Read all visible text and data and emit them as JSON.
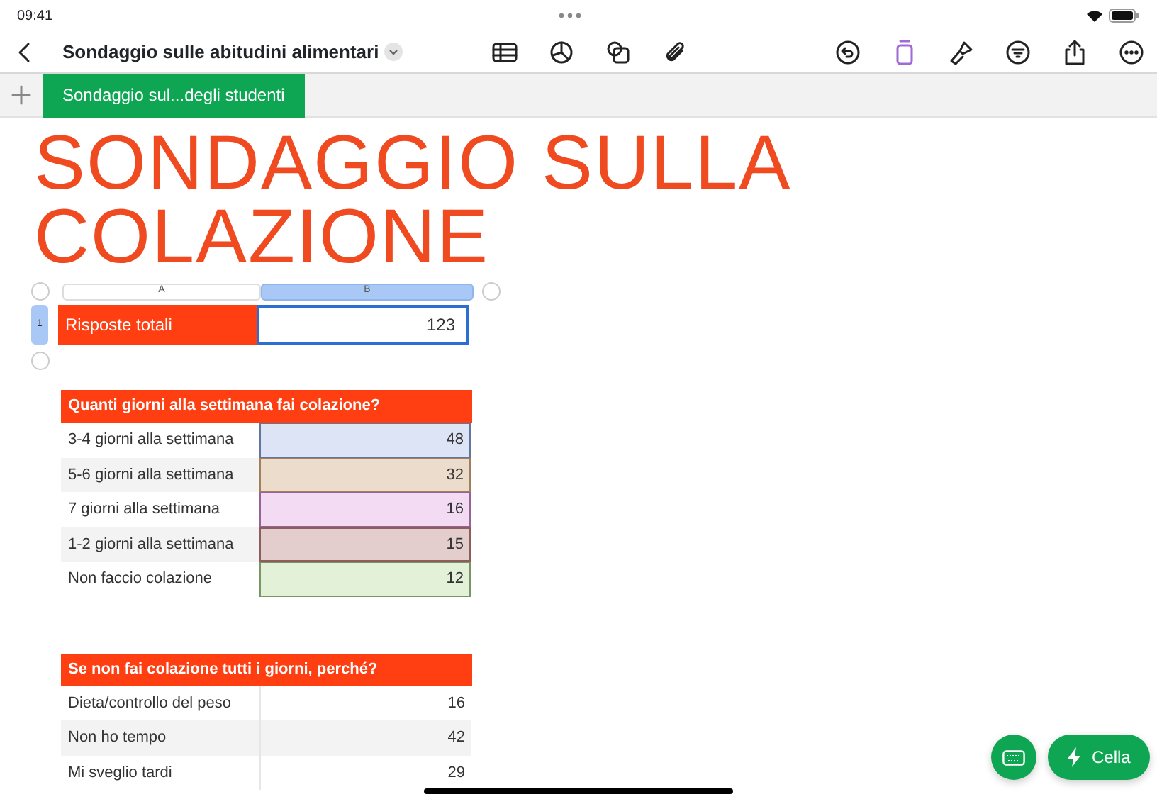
{
  "status_bar": {
    "time": "09:41"
  },
  "toolbar": {
    "document_title": "Sondaggio sulle abitudini alimentari"
  },
  "sheet_tabs": [
    {
      "label": "Sondaggio sul...degli studenti",
      "selected": true
    }
  ],
  "title": "SONDAGGIO SULLA COLAZIONE",
  "summary_table": {
    "columns": [
      {
        "label": "A",
        "selected": false
      },
      {
        "label": "B",
        "selected": true
      }
    ],
    "rows": [
      {
        "number": "1",
        "selected": true,
        "label": "Risposte totali",
        "value": "123"
      }
    ]
  },
  "frequency_table": {
    "header": "Quanti giorni alla settimana fai colazione?",
    "rows": [
      {
        "label": "3-4 giorni alla settimana",
        "value": "48",
        "color": "#dce4f6"
      },
      {
        "label": "5-6 giorni alla settimana",
        "value": "32",
        "color": "#ecdccc"
      },
      {
        "label": "7 giorni alla settimana",
        "value": "16",
        "color": "#f3dcf3"
      },
      {
        "label": "1-2 giorni alla settimana",
        "value": "15",
        "color": "#e3cdcd"
      },
      {
        "label": "Non faccio colazione",
        "value": "12",
        "color": "#e3f1d9"
      }
    ]
  },
  "reasons_table": {
    "header": "Se non fai colazione tutti i giorni, perché?",
    "rows": [
      {
        "label": "Dieta/controllo del peso",
        "value": "16"
      },
      {
        "label": "Non ho tempo",
        "value": "42"
      },
      {
        "label": "Mi sveglio tardi",
        "value": "29"
      }
    ]
  },
  "floating_buttons": {
    "cell_button": "Cella"
  }
}
